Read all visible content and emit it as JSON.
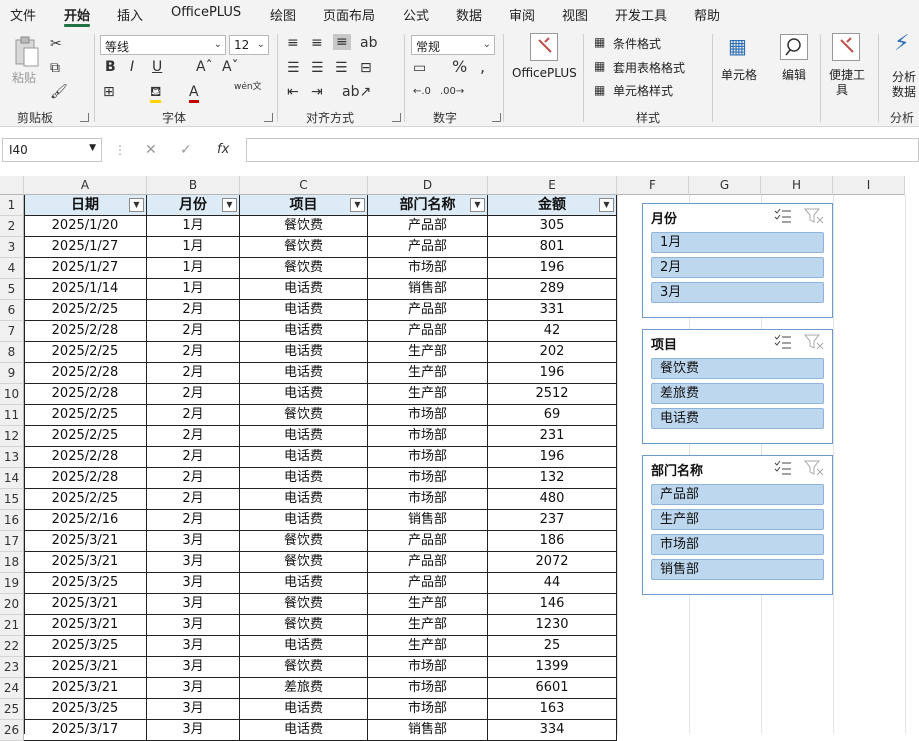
{
  "menu": [
    "文件",
    "开始",
    "插入",
    "OfficePLUS",
    "绘图",
    "页面布局",
    "公式",
    "数据",
    "审阅",
    "视图",
    "开发工具",
    "帮助"
  ],
  "ribbon": {
    "clipboard": {
      "paste": "粘贴",
      "label": "剪贴板"
    },
    "font": {
      "name": "等线",
      "size": "12",
      "label": "字体",
      "phonetic": "wén文"
    },
    "align": {
      "label": "对齐方式"
    },
    "number": {
      "format": "常规",
      "label": "数字"
    },
    "officeplus": {
      "label": "OfficePLUS"
    },
    "styles": {
      "cond": "条件格式",
      "table": "套用表格格式",
      "cell": "单元格样式",
      "label": "样式"
    },
    "cells": {
      "label": "单元格"
    },
    "editing": {
      "label": "编辑"
    },
    "quicktool": {
      "label1": "便捷工",
      "label2": "具"
    },
    "analysis": {
      "label1": "分析",
      "label2": "数据",
      "group": "分析"
    }
  },
  "formula_bar": {
    "name_box": "I40",
    "fx": "fx",
    "value": ""
  },
  "columns": [
    "A",
    "B",
    "C",
    "D",
    "E",
    "F",
    "G",
    "H",
    "I"
  ],
  "table": {
    "headers": [
      "日期",
      "月份",
      "项目",
      "部门名称",
      "金额"
    ],
    "rows": [
      [
        "2025/1/20",
        "1月",
        "餐饮费",
        "产品部",
        "305"
      ],
      [
        "2025/1/27",
        "1月",
        "餐饮费",
        "产品部",
        "801"
      ],
      [
        "2025/1/27",
        "1月",
        "餐饮费",
        "市场部",
        "196"
      ],
      [
        "2025/1/14",
        "1月",
        "电话费",
        "销售部",
        "289"
      ],
      [
        "2025/2/25",
        "2月",
        "电话费",
        "产品部",
        "331"
      ],
      [
        "2025/2/28",
        "2月",
        "电话费",
        "产品部",
        "42"
      ],
      [
        "2025/2/25",
        "2月",
        "电话费",
        "生产部",
        "202"
      ],
      [
        "2025/2/28",
        "2月",
        "电话费",
        "生产部",
        "196"
      ],
      [
        "2025/2/28",
        "2月",
        "电话费",
        "生产部",
        "2512"
      ],
      [
        "2025/2/25",
        "2月",
        "餐饮费",
        "市场部",
        "69"
      ],
      [
        "2025/2/25",
        "2月",
        "电话费",
        "市场部",
        "231"
      ],
      [
        "2025/2/28",
        "2月",
        "电话费",
        "市场部",
        "196"
      ],
      [
        "2025/2/28",
        "2月",
        "电话费",
        "市场部",
        "132"
      ],
      [
        "2025/2/25",
        "2月",
        "电话费",
        "市场部",
        "480"
      ],
      [
        "2025/2/16",
        "2月",
        "电话费",
        "销售部",
        "237"
      ],
      [
        "2025/3/21",
        "3月",
        "餐饮费",
        "产品部",
        "186"
      ],
      [
        "2025/3/21",
        "3月",
        "餐饮费",
        "产品部",
        "2072"
      ],
      [
        "2025/3/25",
        "3月",
        "电话费",
        "产品部",
        "44"
      ],
      [
        "2025/3/21",
        "3月",
        "餐饮费",
        "生产部",
        "146"
      ],
      [
        "2025/3/21",
        "3月",
        "餐饮费",
        "生产部",
        "1230"
      ],
      [
        "2025/3/25",
        "3月",
        "电话费",
        "生产部",
        "25"
      ],
      [
        "2025/3/21",
        "3月",
        "餐饮费",
        "市场部",
        "1399"
      ],
      [
        "2025/3/21",
        "3月",
        "差旅费",
        "市场部",
        "6601"
      ],
      [
        "2025/3/25",
        "3月",
        "电话费",
        "市场部",
        "163"
      ],
      [
        "2025/3/17",
        "3月",
        "电话费",
        "销售部",
        "334"
      ]
    ]
  },
  "slicers": [
    {
      "title": "月份",
      "items": [
        "1月",
        "2月",
        "3月"
      ]
    },
    {
      "title": "项目",
      "items": [
        "餐饮费",
        "差旅费",
        "电话费"
      ]
    },
    {
      "title": "部门名称",
      "items": [
        "产品部",
        "生产部",
        "市场部",
        "销售部"
      ]
    }
  ],
  "colors": {
    "accent": "#217346",
    "header_fill": "#ddebf7",
    "slicer_item": "#bdd7ee",
    "slicer_border": "#6e9bc8"
  }
}
